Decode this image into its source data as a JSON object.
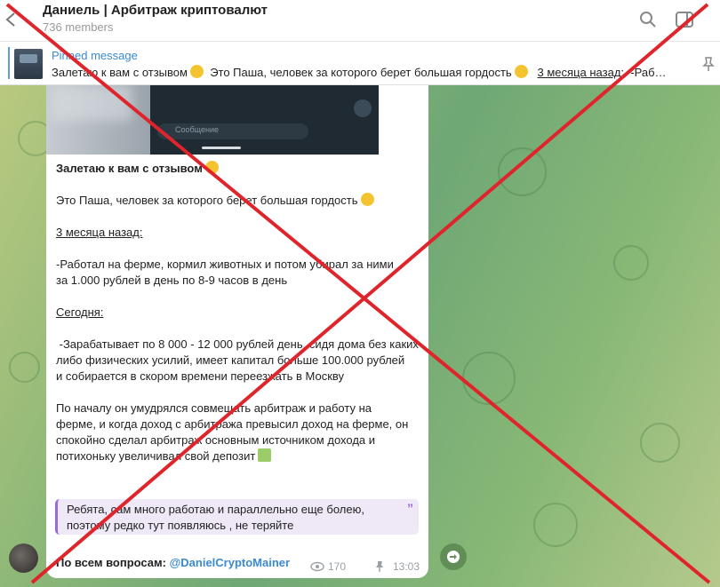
{
  "header": {
    "title": "Даниель | Арбитраж криптовалют",
    "subtitle": "736 members",
    "icons": [
      "back-arrow-icon",
      "search-icon",
      "sidebar-toggle-icon"
    ]
  },
  "pinned": {
    "label": "Pinned message",
    "text_part1": "Залетаю к вам с отзывом",
    "text_part2": "Это Паша, человек за которого берет большая гордость",
    "text_part3": "3 месяца назад:",
    "text_part4": "-Раб…"
  },
  "media": {
    "input_placeholder": "Сообщение"
  },
  "message": {
    "line_title": "Залетаю к вам с отзывом",
    "line_intro": "Это Паша, человек за которого берет большая гордость",
    "before_heading": "3 месяца назад:",
    "before_line1": "-Работал на ферме, кормил животных и потом убирал за ними",
    "before_line2": "за 1.000 рублей в день по 8-9 часов в день",
    "today_heading": "Сегодня:",
    "today_line1": " -Зарабатывает по 8 000 - 12 000 рублей день, сидя дома без каких",
    "today_line2": "либо физических усилий, имеет капитал больше 100.000 рублей",
    "today_line3": "и собирается в скором времени переезжать в Москву",
    "story_line1": "По началу он умудрялся совмещать арбитраж и работу на",
    "story_line2": "ферме, и когда доход с арбитража превысил доход на ферме, он",
    "story_line3": "спокойно сделал арбитраж основным источником дохода и",
    "story_line4": "потихоньку увеличивал свой депозит",
    "quote_line1": "Ребята, сам много работаю и параллельно еще болею,",
    "quote_line2": "поэтому редко тут появляюсь , не теряйте",
    "quote_mark": "”",
    "footer_label": "По всем вопросам:",
    "footer_link": "@DanielCryptoMainer",
    "views": "170",
    "time": "13:03"
  },
  "colors": {
    "link": "#3a8ad3",
    "quote_accent": "#9b6ad6",
    "cross": "#e0242b"
  }
}
